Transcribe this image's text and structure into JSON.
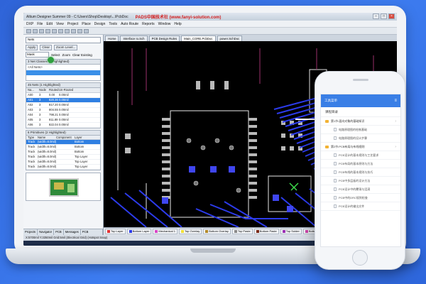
{
  "app": {
    "title": "Altium Designer Summer 09 - C:\\Users\\Shop\\Desktop\\...\\PcbDoc",
    "watermark": "PADS中国技术社 (www.fanyi-solution.com)",
    "menus": [
      "DXP",
      "File",
      "Edit",
      "View",
      "Project",
      "Place",
      "Design",
      "Tools",
      "Auto Route",
      "Reports",
      "Window",
      "Help"
    ],
    "doc_tabs": [
      "Home",
      "Interface Io.Sch",
      "PCB Design Rules",
      "Main_CORE.PcbDoc",
      "power.SchDoc"
    ],
    "layer_tabs": [
      {
        "name": "Top Layer",
        "color": "#e33333"
      },
      {
        "name": "Bottom Layer",
        "color": "#2c3bea"
      },
      {
        "name": "Mechanical 1",
        "color": "#d946c8"
      },
      {
        "name": "Top Overlay",
        "color": "#f2e23a"
      },
      {
        "name": "Bottom Overlay",
        "color": "#b38a2a"
      },
      {
        "name": "Top Paste",
        "color": "#8a8a8a"
      },
      {
        "name": "Bottom Paste",
        "color": "#7a2a1a"
      },
      {
        "name": "Top Solder",
        "color": "#9b2fb5"
      },
      {
        "name": "Bottom Solder",
        "color": "#cc44aa"
      },
      {
        "name": "Drill Guide",
        "color": "#c93a3a"
      },
      {
        "name": "Keep-Out Layer",
        "color": "#d84a9a"
      },
      {
        "name": "Multi-Layer",
        "color": "#b9b9b9"
      }
    ],
    "status": "X:5700mil Y:3350mil   Grid:5mil   (Electrical Grid) (Hotspot Snap)",
    "panel": {
      "filter_select": "Nets",
      "buttons": [
        "Apply",
        "Clear",
        "Zoom Level..."
      ],
      "mask_select": "Mask",
      "mask_options": [
        "Select",
        "Zoom",
        "Clear Existing"
      ],
      "section_net_classes": "3 Net Classes (1 Highlighted)",
      "net_class_first": "<All Nets>",
      "section_nets": "45 Nets (1 Highlighted)",
      "net_headers": [
        "Na...",
        "Node",
        "Routed",
        "Un-Routed"
      ],
      "nets": [
        [
          "A00",
          "3",
          "0.00",
          "0.00mil"
        ],
        [
          "A01",
          "3",
          "820.36",
          "0.00mil"
        ],
        [
          "A02",
          "3",
          "817.20",
          "0.00mil"
        ],
        [
          "A03",
          "3",
          "804.55",
          "0.00mil"
        ],
        [
          "A04",
          "3",
          "798.21",
          "0.00mil"
        ],
        [
          "A05",
          "3",
          "811.89",
          "0.00mil"
        ],
        [
          "A06",
          "3",
          "822.04",
          "0.00mil"
        ]
      ],
      "section_prims": "6 Primitives (2 Highlighted)",
      "prim_headers": [
        "Type",
        "Name",
        "Component",
        "Layer"
      ],
      "prims": [
        [
          "Track",
          "(width=8.0mil)",
          "",
          "Bottom"
        ],
        [
          "Track",
          "(width=8.0mil)",
          "",
          "Bottom"
        ],
        [
          "Track",
          "(width=8.0mil)",
          "",
          "Bottom"
        ],
        [
          "Track",
          "(width=8.0mil)",
          "",
          "Top Layer"
        ],
        [
          "Track",
          "(width=8.0mil)",
          "",
          "Top Layer"
        ],
        [
          "Track",
          "(width=8.0mil)",
          "",
          "Top Layer"
        ]
      ],
      "bottom_tabs": [
        "Projects",
        "Navigator",
        "PCB",
        "Messages",
        "PCB Inspector"
      ]
    }
  },
  "phone": {
    "header_title": "工具菜单",
    "subtitle": "课程目录",
    "items": [
      {
        "type": "group",
        "text": "第1节:面向对象的基础知识"
      },
      {
        "type": "child",
        "text": "电路原理图的绘制基础"
      },
      {
        "type": "child",
        "text": "电路原理图的设计步骤"
      },
      {
        "type": "group",
        "text": "第2节:PCB布局与布线规则"
      },
      {
        "type": "child",
        "text": "PCB设计的基本规则与工艺要求"
      },
      {
        "type": "child",
        "text": "PCB布局的基本原则与方法"
      },
      {
        "type": "child",
        "text": "PCB布线的基本规则与技巧"
      },
      {
        "type": "child",
        "text": "PCB中多层板的设计方法"
      },
      {
        "type": "child",
        "text": "PCB设计中的覆铜与泪滴"
      },
      {
        "type": "child",
        "text": "PCB中的DRC规则检查"
      },
      {
        "type": "child",
        "text": "PCB设计的输出文件"
      }
    ]
  },
  "colors": {
    "background": "#3573e6",
    "bottom_layer": "#2c3bea",
    "top_layer": "#e33333",
    "silkscreen": "#f2e23a",
    "phone_header": "#3a7fe6"
  }
}
